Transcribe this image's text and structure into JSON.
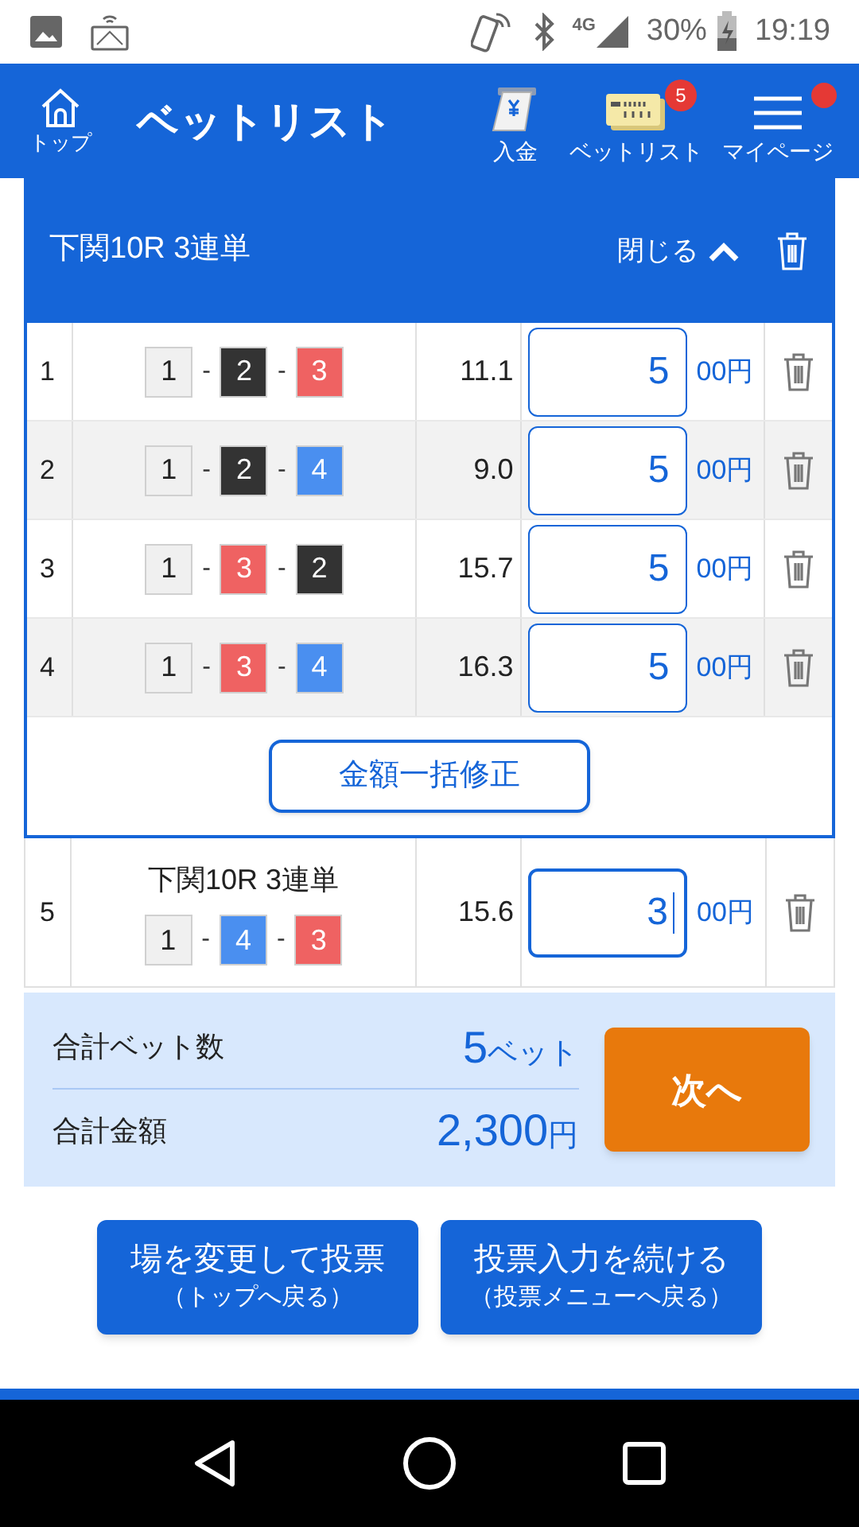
{
  "status_bar": {
    "network": "4G",
    "battery": "30%",
    "time": "19:19"
  },
  "header": {
    "home_label": "トップ",
    "title": "ベットリスト",
    "actions": [
      {
        "kind": "deposit",
        "label": "入金"
      },
      {
        "kind": "betlist",
        "label": "ベットリスト",
        "badge": "5"
      },
      {
        "kind": "menu",
        "label": "マイページ",
        "notification": true
      }
    ]
  },
  "group": {
    "title": "下関10R 3連単",
    "toggle": "閉じる",
    "expanded": true,
    "bets": [
      {
        "no": "1",
        "combo": [
          {
            "num": "1",
            "color": "#f0f0f0"
          },
          {
            "sep": "-",
            "num": "2",
            "color": "#333333"
          },
          {
            "sep": "-",
            "num": "3",
            "color": "#ef6262"
          }
        ],
        "odds": "11.1",
        "amount": "5",
        "unit": "00円"
      },
      {
        "no": "2",
        "combo": [
          {
            "num": "1",
            "color": "#f0f0f0"
          },
          {
            "sep": "-",
            "num": "2",
            "color": "#333333"
          },
          {
            "sep": "-",
            "num": "4",
            "color": "#4a8ff0"
          }
        ],
        "odds": "9.0",
        "amount": "5",
        "unit": "00円"
      },
      {
        "no": "3",
        "combo": [
          {
            "num": "1",
            "color": "#f0f0f0"
          },
          {
            "sep": "-",
            "num": "3",
            "color": "#ef6262"
          },
          {
            "sep": "-",
            "num": "2",
            "color": "#333333"
          }
        ],
        "odds": "15.7",
        "amount": "5",
        "unit": "00円"
      },
      {
        "no": "4",
        "combo": [
          {
            "num": "1",
            "color": "#f0f0f0"
          },
          {
            "sep": "-",
            "num": "3",
            "color": "#ef6262"
          },
          {
            "sep": "-",
            "num": "4",
            "color": "#4a8ff0"
          }
        ],
        "odds": "16.3",
        "amount": "5",
        "unit": "00円"
      }
    ],
    "bulk_button": "金額一括修正"
  },
  "single_bets": [
    {
      "no": "5",
      "race": "下関10R 3連単",
      "combo": [
        {
          "num": "1",
          "color": "#f0f0f0"
        },
        {
          "sep": "-",
          "num": "4",
          "color": "#4a8ff0"
        },
        {
          "sep": "-",
          "num": "3",
          "color": "#ef6262"
        }
      ],
      "odds": "15.6",
      "amount": "3",
      "unit": "00円",
      "focused": true
    }
  ],
  "summary": {
    "count_label": "合計ベット数",
    "count_value": "5",
    "count_unit": "ベット",
    "total_label": "合計金額",
    "total_value": "2,300",
    "total_unit": "円",
    "next_button": "次へ"
  },
  "buttons": [
    {
      "main": "場を変更して投票",
      "sub": "（トップへ戻る）"
    },
    {
      "main": "投票入力を続ける",
      "sub": "（投票メニューへ戻る）"
    }
  ]
}
